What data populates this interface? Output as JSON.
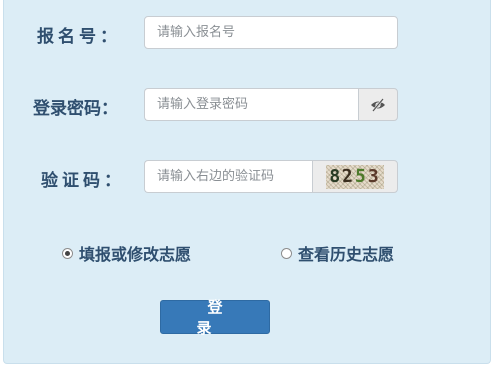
{
  "form": {
    "reg_label": "报名号：",
    "reg_placeholder": "请输入报名号",
    "password_label": "登录密码：",
    "password_placeholder": "请输入登录密码",
    "captcha_label": "验证码：",
    "captcha_placeholder": "请输入右边的验证码",
    "captcha_digits": [
      "8",
      "2",
      "5",
      "3"
    ],
    "eye_icon": "eye-slash-icon"
  },
  "options": [
    {
      "label": "填报或修改志愿",
      "checked": true
    },
    {
      "label": "查看历史志愿",
      "checked": false
    }
  ],
  "login_button": "登 录",
  "colors": {
    "panel_bg": "#dcedf6",
    "label_text": "#2f4f6f",
    "button_bg": "#3779b8"
  }
}
